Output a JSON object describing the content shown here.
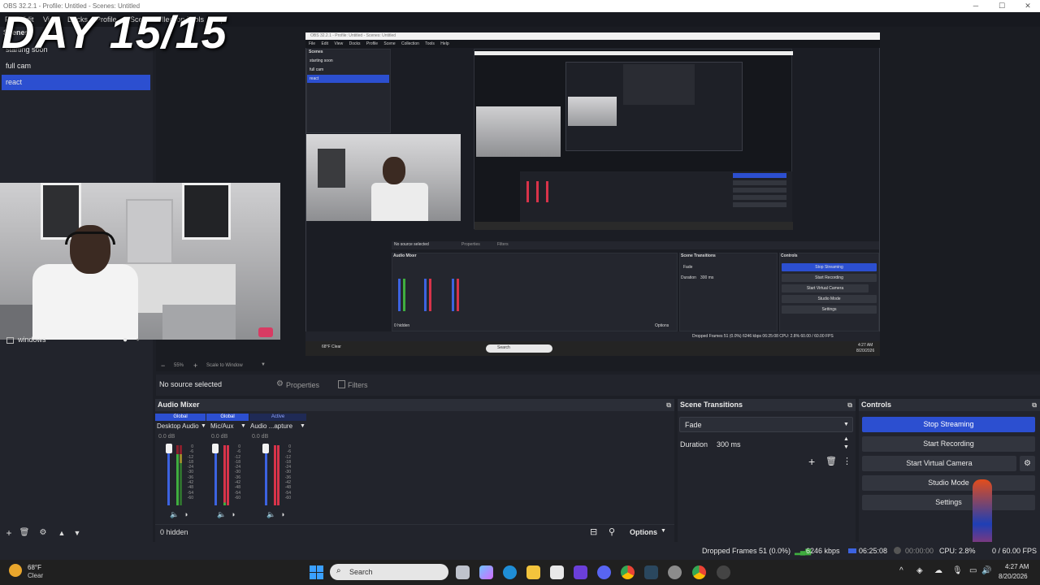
{
  "window": {
    "title": "OBS 32.2.1 - Profile: Untitled - Scenes: Untitled",
    "controls": [
      "─",
      "☐",
      "✕"
    ]
  },
  "menu": [
    "File",
    "Edit",
    "View",
    "Docks",
    "Profile",
    "Scene Collection",
    "Tools",
    "Help"
  ],
  "overlay_title": "DAY 15/15",
  "scenes": {
    "header": "Scenes",
    "items": [
      "starting soon",
      "full cam",
      "react"
    ],
    "selected": "react"
  },
  "sources": {
    "first_item": "windows"
  },
  "preview": {
    "zoom": "55%",
    "scale_mode": "Scale to Window",
    "inner": {
      "title": "OBS 32.2.1 - Profile: Untitled - Scenes: Untitled",
      "menu": "File Edit View Docks Profile Scene Collection Tools Help",
      "scenes_header": "Scenes",
      "scenes": [
        "starting soon",
        "full cam",
        "react"
      ],
      "no_source": "No source selected",
      "properties": "Properties",
      "filters": "Filters",
      "audio_mixer": "Audio Mixer",
      "scene_transitions": "Scene Transitions",
      "controls": "Controls",
      "fade": "Fade",
      "duration_label": "Duration",
      "duration": "300 ms",
      "buttons": [
        "Stop Streaming",
        "Start Recording",
        "Start Virtual Camera",
        "Studio Mode",
        "Settings"
      ],
      "hidden": "0 hidden",
      "options": "Options",
      "status": "Dropped Frames 51 (0.0%)   6246 kbps   06:25:08   CPU: 2.8%   60.00 / 60.00 FPS",
      "weather": "68°F Clear",
      "search": "Search",
      "clock_time": "4:27 AM",
      "clock_date": "8/20/2026"
    }
  },
  "source_bar": {
    "no_source": "No source selected",
    "properties": "Properties",
    "filters": "Filters"
  },
  "audio_mixer": {
    "title": "Audio Mixer",
    "groups": [
      {
        "label": "Global",
        "style": "active"
      },
      {
        "label": "Global",
        "style": "active"
      },
      {
        "label": "Active",
        "style": "dark"
      }
    ],
    "channels": [
      {
        "name": "Desktop Audio",
        "db": "0.0 dB"
      },
      {
        "name": "Mic/Aux",
        "db": "0.0 dB"
      },
      {
        "name": "Audio ...apture",
        "db": "0.0 dB"
      }
    ],
    "scale": [
      "0",
      "-6",
      "-12",
      "-18",
      "-24",
      "-30",
      "-36",
      "-42",
      "-48",
      "-54",
      "-60"
    ],
    "hidden_label": "0 hidden",
    "options_label": "Options"
  },
  "scene_transitions": {
    "title": "Scene Transitions",
    "transition": "Fade",
    "duration_label": "Duration",
    "duration": "300 ms"
  },
  "controls": {
    "title": "Controls",
    "stop_streaming": "Stop Streaming",
    "start_recording": "Start Recording",
    "start_virtual_camera": "Start Virtual Camera",
    "studio_mode": "Studio Mode",
    "settings": "Settings"
  },
  "status": {
    "dropped_frames": "Dropped Frames 51 (0.0%)",
    "bitrate": "6246 kbps",
    "stream_time": "06:25:08",
    "record_time": "00:00:00",
    "cpu": "CPU: 2.8%",
    "fps": "0 / 60.00 FPS"
  },
  "taskbar": {
    "weather_temp": "68°F",
    "weather_desc": "Clear",
    "search_placeholder": "Search",
    "time": "4:27 AM",
    "date": "8/20/2026"
  },
  "colors": {
    "accent": "#2c4fd0",
    "dock_bg": "#22242c",
    "preview_bg": "#1a1c22",
    "meter_green": "#3fae3f",
    "meter_red": "#d8334a"
  }
}
